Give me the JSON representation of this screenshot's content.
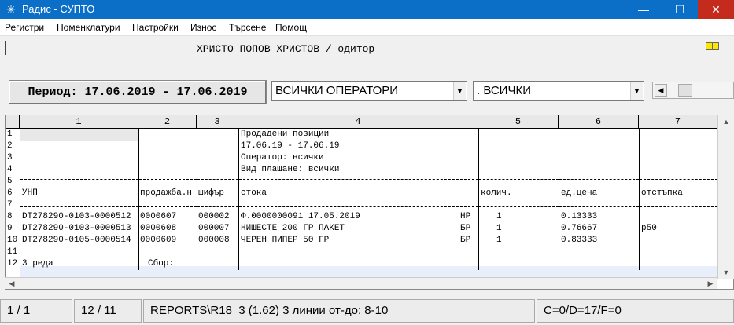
{
  "window": {
    "title": "Радис - СУПТО",
    "minimize": "—",
    "maximize": "☐",
    "close": "✕",
    "icon": "app-star-icon"
  },
  "menu": [
    "Регистри",
    "Номенклатури",
    "Настройки",
    "Износ",
    "Търсене",
    "Помощ"
  ],
  "header": {
    "user": "ХРИСТО ПОПОВ ХРИСТОВ / одитор"
  },
  "filters": {
    "period": "Период: 17.06.2019 - 17.06.2019",
    "operators": "ВСИЧКИ ОПЕРАТОРИ",
    "all": ".   ВСИЧКИ"
  },
  "grid": {
    "columns": [
      "1",
      "2",
      "3",
      "4",
      "5",
      "6",
      "7"
    ],
    "row_numbers": [
      "1",
      "2",
      "3",
      "4",
      "5",
      "6",
      "7",
      "8",
      "9",
      "10",
      "11",
      "12"
    ],
    "report_title": "Продадени позиции",
    "report_period": "17.06.19 - 17.06.19",
    "report_operator": "Оператор: всички",
    "report_payment": "Вид плащане: всички",
    "headers": [
      "УНП",
      "продажба.н",
      "шифър",
      "стока",
      "колич.",
      "ед.цена",
      "отстъпка"
    ],
    "rows": [
      {
        "unp": "DT278290-0103-0000512",
        "sale": "0000607",
        "code": "000002",
        "item": "Ф.0000000091 17.05.2019",
        "vat": "НР",
        "qty": "1",
        "price": "0.13333",
        "discount": ""
      },
      {
        "unp": "DT278290-0103-0000513",
        "sale": "0000608",
        "code": "000007",
        "item": "НИШЕСТЕ 200 ГР ПАКЕТ",
        "vat": "БР",
        "qty": "1",
        "price": "0.76667",
        "discount": "p50"
      },
      {
        "unp": "DT278290-0105-0000514",
        "sale": "0000609",
        "code": "000008",
        "item": "ЧЕРЕН ПИПЕР 50 ГР",
        "vat": "БР",
        "qty": "1",
        "price": "0.83333",
        "discount": ""
      }
    ],
    "footer_rows": "3 реда",
    "footer_sum": "Сбор:"
  },
  "status": {
    "position": "1 / 1",
    "rows": "12 / 11",
    "report": "REPORTS\\R18_3 (1.62) 3 линии от-до: 8-10",
    "counters": "C=0/D=17/F=0"
  }
}
